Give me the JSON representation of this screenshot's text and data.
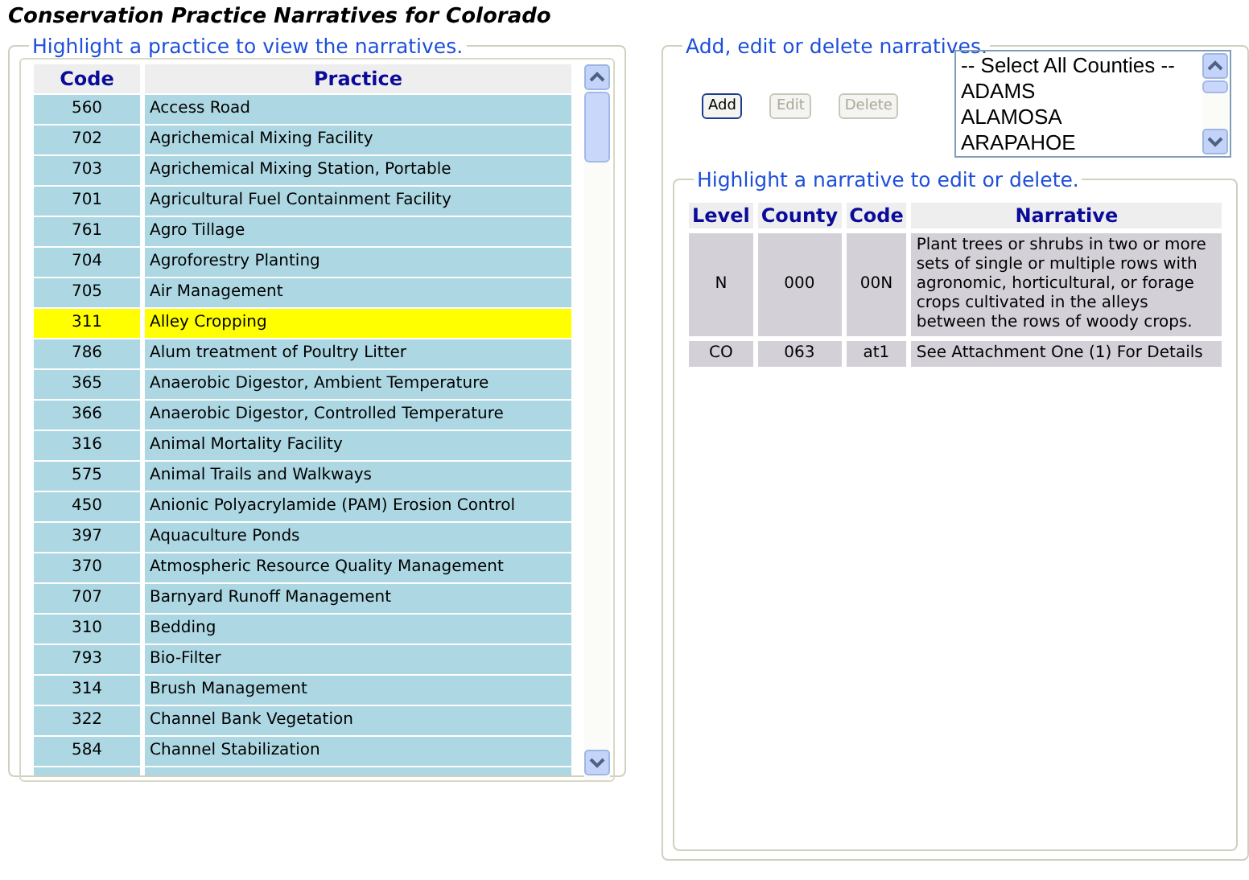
{
  "title": "Conservation Practice Narratives for Colorado",
  "practices": {
    "legend": "Highlight a practice to view the narratives.",
    "columns": [
      "Code",
      "Practice"
    ],
    "rows": [
      {
        "code": "560",
        "name": "Access Road",
        "selected": false
      },
      {
        "code": "702",
        "name": "Agrichemical Mixing Facility",
        "selected": false
      },
      {
        "code": "703",
        "name": "Agrichemical Mixing Station, Portable",
        "selected": false
      },
      {
        "code": "701",
        "name": "Agricultural Fuel Containment Facility",
        "selected": false
      },
      {
        "code": "761",
        "name": "Agro Tillage",
        "selected": false
      },
      {
        "code": "704",
        "name": "Agroforestry Planting",
        "selected": false
      },
      {
        "code": "705",
        "name": "Air Management",
        "selected": false
      },
      {
        "code": "311",
        "name": "Alley Cropping",
        "selected": true
      },
      {
        "code": "786",
        "name": "Alum treatment of Poultry Litter",
        "selected": false
      },
      {
        "code": "365",
        "name": "Anaerobic Digestor, Ambient Temperature",
        "selected": false
      },
      {
        "code": "366",
        "name": "Anaerobic Digestor, Controlled Temperature",
        "selected": false
      },
      {
        "code": "316",
        "name": "Animal Mortality Facility",
        "selected": false
      },
      {
        "code": "575",
        "name": "Animal Trails and Walkways",
        "selected": false
      },
      {
        "code": "450",
        "name": "Anionic Polyacrylamide (PAM) Erosion Control",
        "selected": false
      },
      {
        "code": "397",
        "name": "Aquaculture Ponds",
        "selected": false
      },
      {
        "code": "370",
        "name": "Atmospheric Resource Quality Management",
        "selected": false
      },
      {
        "code": "707",
        "name": "Barnyard Runoff Management",
        "selected": false
      },
      {
        "code": "310",
        "name": "Bedding",
        "selected": false
      },
      {
        "code": "793",
        "name": "Bio-Filter",
        "selected": false
      },
      {
        "code": "314",
        "name": "Brush Management",
        "selected": false
      },
      {
        "code": "322",
        "name": "Channel Bank Vegetation",
        "selected": false
      },
      {
        "code": "584",
        "name": "Channel Stabilization",
        "selected": false
      }
    ]
  },
  "editor": {
    "legend": "Add, edit or delete narratives.",
    "buttons": [
      {
        "label": "Add",
        "disabled": false
      },
      {
        "label": "Edit",
        "disabled": true
      },
      {
        "label": "Delete",
        "disabled": true
      }
    ],
    "counties": [
      {
        "label": "-- Select All Counties --",
        "selected": false
      },
      {
        "label": "ADAMS",
        "selected": false
      },
      {
        "label": "ALAMOSA",
        "selected": false
      },
      {
        "label": "ARAPAHOE",
        "selected": false
      }
    ],
    "narratives": {
      "legend": "Highlight a narrative to edit or delete.",
      "columns": [
        "Level",
        "County",
        "Code",
        "Narrative"
      ],
      "rows": [
        {
          "level": "N",
          "county": "000",
          "code": "00N",
          "narrative": "Plant trees or shrubs in two or more sets of single or multiple rows with agronomic, horticultural, or forage crops cultivated in the alleys between the rows of woody crops.",
          "selected": false
        },
        {
          "level": "CO",
          "county": "063",
          "code": "at1",
          "narrative": "See Attachment One (1) For Details",
          "selected": false
        }
      ]
    }
  }
}
